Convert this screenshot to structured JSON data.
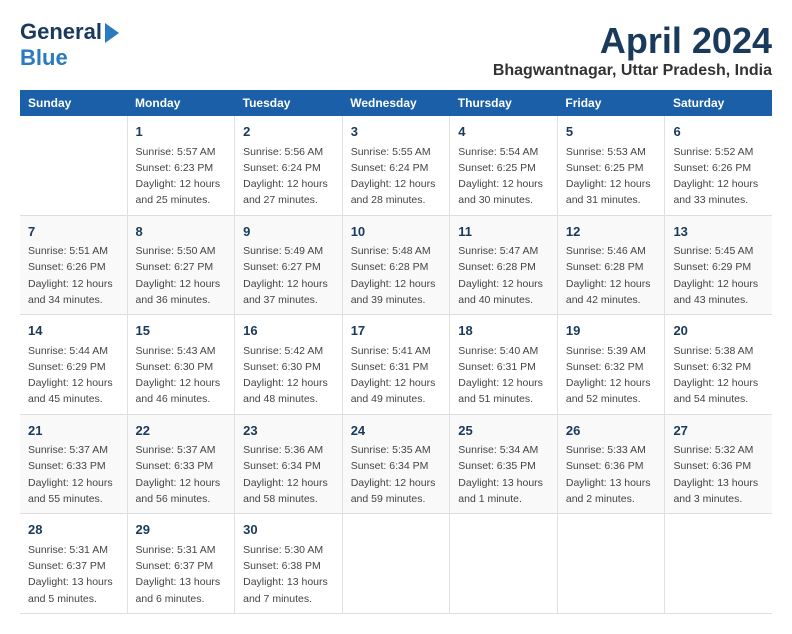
{
  "logo": {
    "line1": "General",
    "line2": "Blue"
  },
  "title": "April 2024",
  "subtitle": "Bhagwantnagar, Uttar Pradesh, India",
  "headers": [
    "Sunday",
    "Monday",
    "Tuesday",
    "Wednesday",
    "Thursday",
    "Friday",
    "Saturday"
  ],
  "weeks": [
    [
      {
        "day": "",
        "text": ""
      },
      {
        "day": "1",
        "text": "Sunrise: 5:57 AM\nSunset: 6:23 PM\nDaylight: 12 hours\nand 25 minutes."
      },
      {
        "day": "2",
        "text": "Sunrise: 5:56 AM\nSunset: 6:24 PM\nDaylight: 12 hours\nand 27 minutes."
      },
      {
        "day": "3",
        "text": "Sunrise: 5:55 AM\nSunset: 6:24 PM\nDaylight: 12 hours\nand 28 minutes."
      },
      {
        "day": "4",
        "text": "Sunrise: 5:54 AM\nSunset: 6:25 PM\nDaylight: 12 hours\nand 30 minutes."
      },
      {
        "day": "5",
        "text": "Sunrise: 5:53 AM\nSunset: 6:25 PM\nDaylight: 12 hours\nand 31 minutes."
      },
      {
        "day": "6",
        "text": "Sunrise: 5:52 AM\nSunset: 6:26 PM\nDaylight: 12 hours\nand 33 minutes."
      }
    ],
    [
      {
        "day": "7",
        "text": "Sunrise: 5:51 AM\nSunset: 6:26 PM\nDaylight: 12 hours\nand 34 minutes."
      },
      {
        "day": "8",
        "text": "Sunrise: 5:50 AM\nSunset: 6:27 PM\nDaylight: 12 hours\nand 36 minutes."
      },
      {
        "day": "9",
        "text": "Sunrise: 5:49 AM\nSunset: 6:27 PM\nDaylight: 12 hours\nand 37 minutes."
      },
      {
        "day": "10",
        "text": "Sunrise: 5:48 AM\nSunset: 6:28 PM\nDaylight: 12 hours\nand 39 minutes."
      },
      {
        "day": "11",
        "text": "Sunrise: 5:47 AM\nSunset: 6:28 PM\nDaylight: 12 hours\nand 40 minutes."
      },
      {
        "day": "12",
        "text": "Sunrise: 5:46 AM\nSunset: 6:28 PM\nDaylight: 12 hours\nand 42 minutes."
      },
      {
        "day": "13",
        "text": "Sunrise: 5:45 AM\nSunset: 6:29 PM\nDaylight: 12 hours\nand 43 minutes."
      }
    ],
    [
      {
        "day": "14",
        "text": "Sunrise: 5:44 AM\nSunset: 6:29 PM\nDaylight: 12 hours\nand 45 minutes."
      },
      {
        "day": "15",
        "text": "Sunrise: 5:43 AM\nSunset: 6:30 PM\nDaylight: 12 hours\nand 46 minutes."
      },
      {
        "day": "16",
        "text": "Sunrise: 5:42 AM\nSunset: 6:30 PM\nDaylight: 12 hours\nand 48 minutes."
      },
      {
        "day": "17",
        "text": "Sunrise: 5:41 AM\nSunset: 6:31 PM\nDaylight: 12 hours\nand 49 minutes."
      },
      {
        "day": "18",
        "text": "Sunrise: 5:40 AM\nSunset: 6:31 PM\nDaylight: 12 hours\nand 51 minutes."
      },
      {
        "day": "19",
        "text": "Sunrise: 5:39 AM\nSunset: 6:32 PM\nDaylight: 12 hours\nand 52 minutes."
      },
      {
        "day": "20",
        "text": "Sunrise: 5:38 AM\nSunset: 6:32 PM\nDaylight: 12 hours\nand 54 minutes."
      }
    ],
    [
      {
        "day": "21",
        "text": "Sunrise: 5:37 AM\nSunset: 6:33 PM\nDaylight: 12 hours\nand 55 minutes."
      },
      {
        "day": "22",
        "text": "Sunrise: 5:37 AM\nSunset: 6:33 PM\nDaylight: 12 hours\nand 56 minutes."
      },
      {
        "day": "23",
        "text": "Sunrise: 5:36 AM\nSunset: 6:34 PM\nDaylight: 12 hours\nand 58 minutes."
      },
      {
        "day": "24",
        "text": "Sunrise: 5:35 AM\nSunset: 6:34 PM\nDaylight: 12 hours\nand 59 minutes."
      },
      {
        "day": "25",
        "text": "Sunrise: 5:34 AM\nSunset: 6:35 PM\nDaylight: 13 hours\nand 1 minute."
      },
      {
        "day": "26",
        "text": "Sunrise: 5:33 AM\nSunset: 6:36 PM\nDaylight: 13 hours\nand 2 minutes."
      },
      {
        "day": "27",
        "text": "Sunrise: 5:32 AM\nSunset: 6:36 PM\nDaylight: 13 hours\nand 3 minutes."
      }
    ],
    [
      {
        "day": "28",
        "text": "Sunrise: 5:31 AM\nSunset: 6:37 PM\nDaylight: 13 hours\nand 5 minutes."
      },
      {
        "day": "29",
        "text": "Sunrise: 5:31 AM\nSunset: 6:37 PM\nDaylight: 13 hours\nand 6 minutes."
      },
      {
        "day": "30",
        "text": "Sunrise: 5:30 AM\nSunset: 6:38 PM\nDaylight: 13 hours\nand 7 minutes."
      },
      {
        "day": "",
        "text": ""
      },
      {
        "day": "",
        "text": ""
      },
      {
        "day": "",
        "text": ""
      },
      {
        "day": "",
        "text": ""
      }
    ]
  ]
}
